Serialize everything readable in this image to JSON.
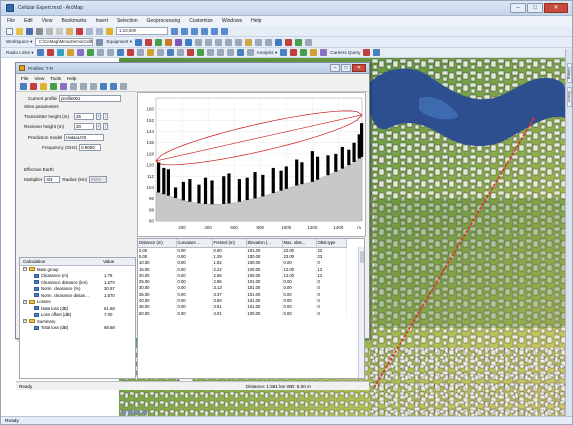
{
  "app": {
    "title": "Cellular Expert.mxd - ArcMap"
  },
  "menu": [
    "File",
    "Edit",
    "View",
    "Bookmarks",
    "Insert",
    "Selection",
    "Geoprocessing",
    "Customize",
    "Windows",
    "Help"
  ],
  "toolbar": {
    "scale": "1:10,000",
    "workspace_label": "Workspace ▾",
    "workspace_path": "C:\\CeMap\\MenuDemo\\CellExp.mdb",
    "equipment_label": "Equipment ▾",
    "radio_links_label": "Radio Links ▾",
    "analysis_label": "Analysis ▾",
    "carriers_query_label": "Carriers Query"
  },
  "side_tabs": [
    "Catalog",
    "Search"
  ],
  "status": {
    "left": "Ready"
  },
  "profile": {
    "title": "Profiles: T-R",
    "menu": [
      "File",
      "View",
      "Tools",
      "Help"
    ],
    "current_profile_label": "Current profile",
    "current_profile": "profile001",
    "sites_params_label": "Sites parameters",
    "tx_height_label": "Transmitter height (m)",
    "tx_height": "26",
    "rx_height_label": "Reciever height (m)",
    "rx_height": "30",
    "prediction_model_label": "Prediction model",
    "prediction_model": "HataxLOS",
    "frequency_label": "Frequency (GHz)",
    "frequency": "0.9000",
    "effective_earth_label": "Effective Earth",
    "multiplier_label": "Multiplier",
    "multiplier": "4/3",
    "radius_label": "Radius (km)",
    "radius": "8500",
    "calc_headers": [
      "Calculation",
      "Value"
    ],
    "calc_rows": [
      {
        "name": "Main group",
        "value": "",
        "level": 0,
        "type": "folder"
      },
      {
        "name": "Clearance (m)",
        "value": "1.76",
        "level": 1,
        "type": "leaf"
      },
      {
        "name": "Clearance distance (km)",
        "value": "1.570",
        "level": 1,
        "type": "leaf"
      },
      {
        "name": "Norm. clearance (%)",
        "value": "30.57",
        "level": 1,
        "type": "leaf"
      },
      {
        "name": "Norm. clearance distan...",
        "value": "1.570",
        "level": 1,
        "type": "leaf"
      },
      {
        "name": "Losses",
        "value": "",
        "level": 0,
        "type": "folder"
      },
      {
        "name": "Hata loss (dB)",
        "value": "61.68",
        "level": 1,
        "type": "leaf"
      },
      {
        "name": "Loss offset (dB)",
        "value": "7.00",
        "level": 1,
        "type": "leaf"
      },
      {
        "name": "Summary",
        "value": "",
        "level": 0,
        "type": "folder"
      },
      {
        "name": "Total loss (dB)",
        "value": "68.68",
        "level": 1,
        "type": "leaf"
      }
    ],
    "grid_headers": [
      "Distance (m)",
      "Curvature ...",
      "Fresnel (m)",
      "Elevation (...",
      "Max. obst...",
      "Obst.type"
    ],
    "grid_rows": [
      [
        "0.00",
        "0.00",
        "0.00",
        "101.00",
        "22.00",
        "22"
      ],
      [
        "5.00",
        "0.00",
        "1.29",
        "100.00",
        "23.00",
        "23"
      ],
      [
        "10.00",
        "0.00",
        "1.82",
        "100.00",
        "0.00",
        "0"
      ],
      [
        "15.00",
        "0.00",
        "2.22",
        "100.00",
        "12.00",
        "12"
      ],
      [
        "20.00",
        "0.00",
        "2.56",
        "100.00",
        "12.00",
        "12"
      ],
      [
        "25.00",
        "0.00",
        "2.86",
        "101.00",
        "0.00",
        "0"
      ],
      [
        "30.00",
        "0.00",
        "3.13",
        "101.00",
        "0.00",
        "0"
      ],
      [
        "35.00",
        "0.00",
        "3.37",
        "101.00",
        "0.00",
        "0"
      ],
      [
        "40.00",
        "0.00",
        "3.60",
        "101.00",
        "0.00",
        "0"
      ],
      [
        "45.00",
        "0.00",
        "3.81",
        "101.00",
        "0.00",
        "0"
      ],
      [
        "50.00",
        "0.00",
        "4.01",
        "100.00",
        "0.00",
        "0"
      ]
    ],
    "status_left": "Ready",
    "status_right": "Distance: 1.581 km   WD: 5.00 m"
  },
  "chart_data": {
    "type": "area",
    "x_ticks": [
      200,
      400,
      600,
      800,
      1000,
      1200,
      1400
    ],
    "x_unit_label": "m",
    "y_ticks": [
      80,
      88,
      96,
      104,
      112,
      120,
      128,
      136,
      144,
      152,
      160
    ],
    "xlim": [
      0,
      1581
    ],
    "ylim": [
      80,
      168
    ],
    "terrain": {
      "x": [
        0,
        100,
        200,
        300,
        400,
        500,
        600,
        700,
        800,
        900,
        1000,
        1100,
        1200,
        1300,
        1400,
        1500,
        1581
      ],
      "y": [
        101,
        98,
        95,
        93,
        92,
        92,
        93,
        95,
        97,
        100,
        103,
        106,
        108,
        112,
        116,
        121,
        126
      ]
    },
    "clutter_heights": [
      {
        "x": 20,
        "top": 122
      },
      {
        "x": 60,
        "top": 118
      },
      {
        "x": 95,
        "top": 117
      },
      {
        "x": 150,
        "top": 104
      },
      {
        "x": 210,
        "top": 108
      },
      {
        "x": 260,
        "top": 110
      },
      {
        "x": 330,
        "top": 106
      },
      {
        "x": 380,
        "top": 111
      },
      {
        "x": 430,
        "top": 109
      },
      {
        "x": 520,
        "top": 112
      },
      {
        "x": 560,
        "top": 114
      },
      {
        "x": 640,
        "top": 110
      },
      {
        "x": 700,
        "top": 111
      },
      {
        "x": 760,
        "top": 115
      },
      {
        "x": 820,
        "top": 113
      },
      {
        "x": 900,
        "top": 118
      },
      {
        "x": 960,
        "top": 116
      },
      {
        "x": 1000,
        "top": 119
      },
      {
        "x": 1080,
        "top": 124
      },
      {
        "x": 1120,
        "top": 122
      },
      {
        "x": 1200,
        "top": 130
      },
      {
        "x": 1240,
        "top": 126
      },
      {
        "x": 1320,
        "top": 127
      },
      {
        "x": 1380,
        "top": 128
      },
      {
        "x": 1430,
        "top": 133
      },
      {
        "x": 1480,
        "top": 131
      },
      {
        "x": 1520,
        "top": 136
      },
      {
        "x": 1560,
        "top": 142
      },
      {
        "x": 1578,
        "top": 150
      }
    ],
    "los": {
      "x": [
        0,
        1581
      ],
      "y": [
        123,
        156
      ]
    },
    "fresnel_radius_max": 10,
    "colors": {
      "terrain": "#c8c8c8",
      "clutter": "#000000",
      "fresnel": "#cc1a1a",
      "los": "#cc1a1a"
    }
  }
}
